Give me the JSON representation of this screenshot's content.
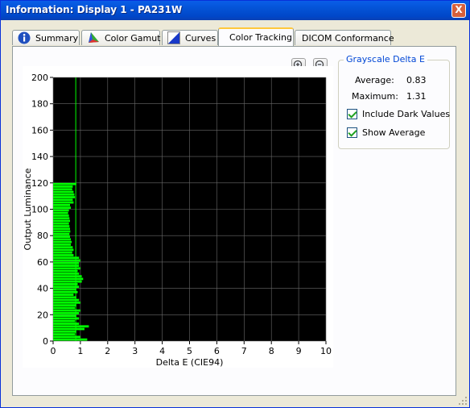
{
  "window": {
    "title": "Information: Display 1 - PA231W",
    "close_label": "X"
  },
  "tabs": [
    {
      "label": "Summary",
      "icon": "info-icon"
    },
    {
      "label": "Color Gamut",
      "icon": "color-gamut-icon"
    },
    {
      "label": "Curves",
      "icon": "curves-icon"
    },
    {
      "label": "Color Tracking",
      "icon": "",
      "active": true
    },
    {
      "label": "DICOM Conformance",
      "icon": ""
    }
  ],
  "zoom": {
    "in_icon": "zoom-in-icon",
    "out_icon": "zoom-out-icon"
  },
  "grayscale": {
    "title": "Grayscale Delta E",
    "average_label": "Average:",
    "average_value": "0.83",
    "maximum_label": "Maximum:",
    "maximum_value": "1.31",
    "include_dark_label": "Include Dark Values",
    "include_dark_checked": true,
    "show_average_label": "Show Average",
    "show_average_checked": true
  },
  "chart_data": {
    "type": "bar",
    "orientation": "horizontal",
    "xlabel": "Delta E (CIE94)",
    "ylabel": "Output Luminance",
    "xlim": [
      0,
      10
    ],
    "ylim": [
      0,
      200
    ],
    "xticks": [
      0,
      1,
      2,
      3,
      4,
      5,
      6,
      7,
      8,
      9,
      10
    ],
    "yticks": [
      0,
      20,
      40,
      60,
      80,
      100,
      120,
      140,
      160,
      180,
      200
    ],
    "grid": true,
    "background": "#000000",
    "bar_color": "#00ff00",
    "average_line": 0.83,
    "bars": [
      {
        "y": 1,
        "x": 1.25
      },
      {
        "y": 3,
        "x": 1.0
      },
      {
        "y": 5,
        "x": 0.8
      },
      {
        "y": 7,
        "x": 0.85
      },
      {
        "y": 9,
        "x": 1.15
      },
      {
        "y": 11,
        "x": 1.31
      },
      {
        "y": 13,
        "x": 0.95
      },
      {
        "y": 15,
        "x": 0.8
      },
      {
        "y": 17,
        "x": 0.95
      },
      {
        "y": 19,
        "x": 0.85
      },
      {
        "y": 21,
        "x": 0.95
      },
      {
        "y": 23,
        "x": 1.0
      },
      {
        "y": 25,
        "x": 0.8
      },
      {
        "y": 27,
        "x": 0.85
      },
      {
        "y": 29,
        "x": 1.0
      },
      {
        "y": 31,
        "x": 0.95
      },
      {
        "y": 33,
        "x": 0.85
      },
      {
        "y": 35,
        "x": 0.75
      },
      {
        "y": 37,
        "x": 0.9
      },
      {
        "y": 39,
        "x": 0.85
      },
      {
        "y": 41,
        "x": 0.95
      },
      {
        "y": 43,
        "x": 0.9
      },
      {
        "y": 45,
        "x": 1.05
      },
      {
        "y": 47,
        "x": 1.1
      },
      {
        "y": 49,
        "x": 1.05
      },
      {
        "y": 51,
        "x": 0.95
      },
      {
        "y": 53,
        "x": 0.9
      },
      {
        "y": 55,
        "x": 1.0
      },
      {
        "y": 57,
        "x": 0.95
      },
      {
        "y": 59,
        "x": 0.95
      },
      {
        "y": 61,
        "x": 1.0
      },
      {
        "y": 63,
        "x": 0.95
      },
      {
        "y": 65,
        "x": 0.75
      },
      {
        "y": 67,
        "x": 0.7
      },
      {
        "y": 69,
        "x": 0.75
      },
      {
        "y": 71,
        "x": 0.72
      },
      {
        "y": 73,
        "x": 0.65
      },
      {
        "y": 75,
        "x": 0.68
      },
      {
        "y": 77,
        "x": 0.65
      },
      {
        "y": 79,
        "x": 0.62
      },
      {
        "y": 81,
        "x": 0.6
      },
      {
        "y": 83,
        "x": 0.63
      },
      {
        "y": 85,
        "x": 0.62
      },
      {
        "y": 87,
        "x": 0.6
      },
      {
        "y": 89,
        "x": 0.58
      },
      {
        "y": 91,
        "x": 0.62
      },
      {
        "y": 93,
        "x": 0.6
      },
      {
        "y": 95,
        "x": 0.58
      },
      {
        "y": 97,
        "x": 0.55
      },
      {
        "y": 99,
        "x": 0.58
      },
      {
        "y": 101,
        "x": 0.65
      },
      {
        "y": 103,
        "x": 0.62
      },
      {
        "y": 105,
        "x": 0.75
      },
      {
        "y": 107,
        "x": 0.72
      },
      {
        "y": 109,
        "x": 0.8
      },
      {
        "y": 111,
        "x": 0.78
      },
      {
        "y": 113,
        "x": 0.75
      },
      {
        "y": 115,
        "x": 0.7
      },
      {
        "y": 117,
        "x": 0.72
      },
      {
        "y": 119,
        "x": 0.85
      }
    ]
  }
}
